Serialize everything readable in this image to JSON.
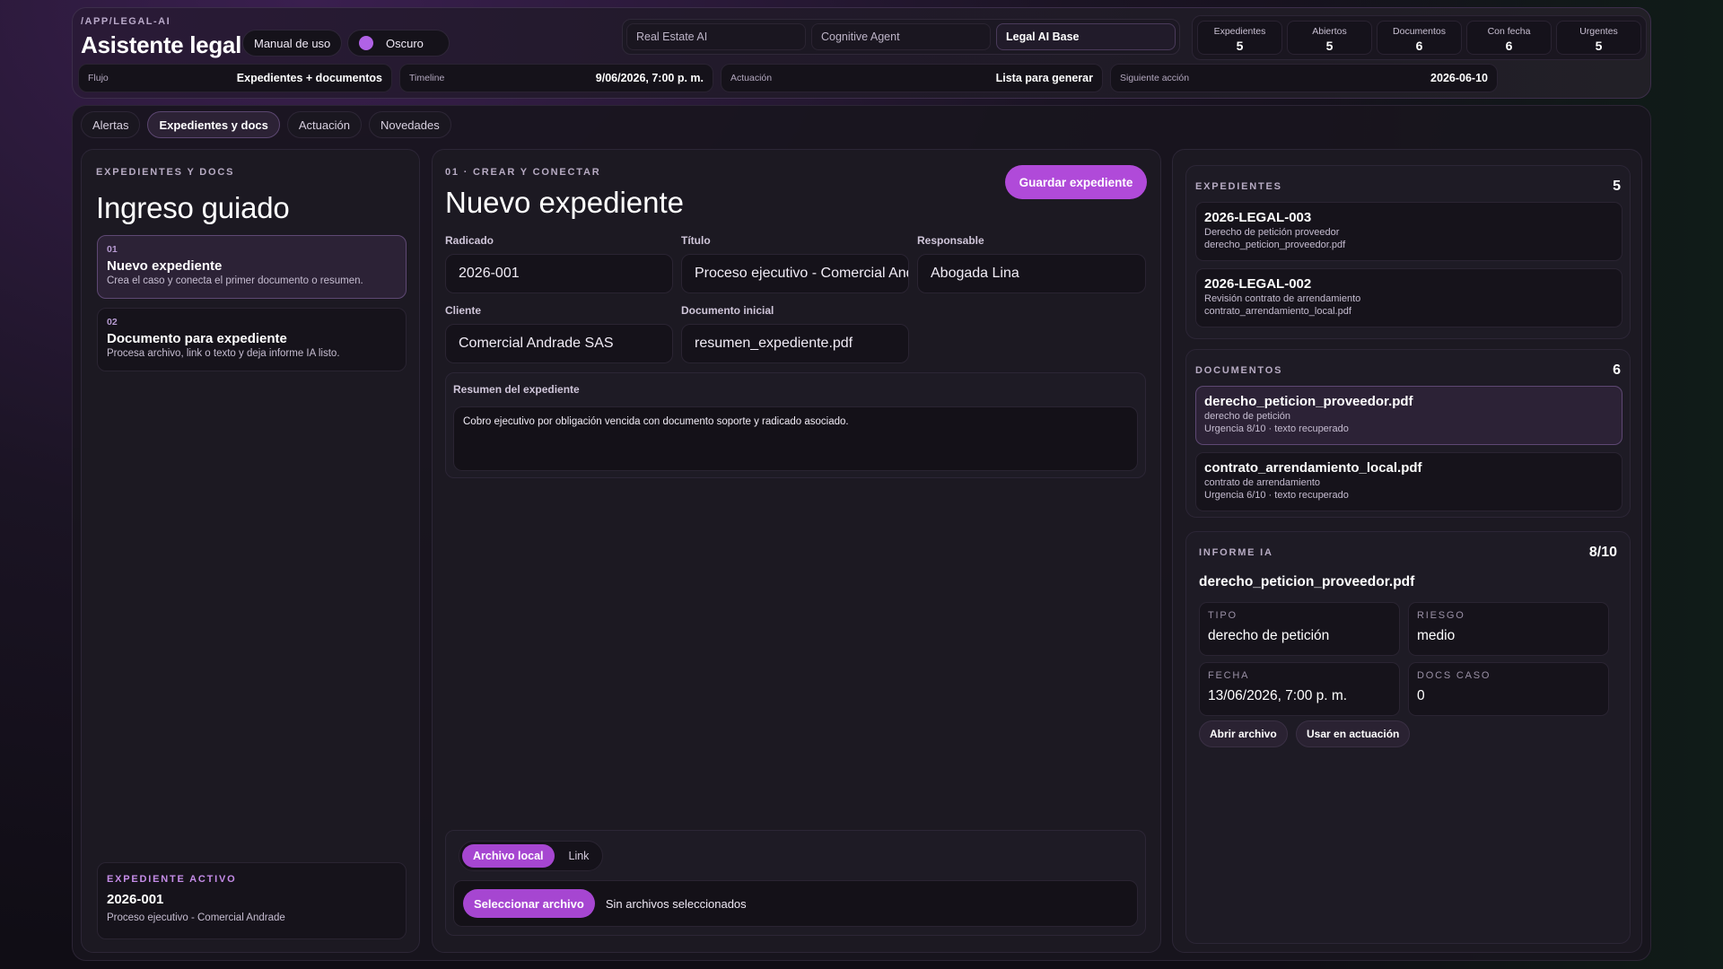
{
  "header": {
    "crumb": "/APP/LEGAL-AI",
    "title": "Asistente legal",
    "manual_label": "Manual de uso",
    "theme_label": "Oscuro",
    "workspaces": [
      "Real Estate AI",
      "Cognitive Agent",
      "Legal AI Base"
    ],
    "active_workspace": "Legal AI Base",
    "stats": [
      {
        "label": "Expedientes",
        "value": "5"
      },
      {
        "label": "Abiertos",
        "value": "5"
      },
      {
        "label": "Documentos",
        "value": "6"
      },
      {
        "label": "Con fecha",
        "value": "6"
      },
      {
        "label": "Urgentes",
        "value": "5"
      }
    ],
    "meta": [
      {
        "key": "Flujo",
        "value": "Expedientes + documentos"
      },
      {
        "key": "Timeline",
        "value": "9/06/2026, 7:00 p. m."
      },
      {
        "key": "Actuación",
        "value": "Lista para generar"
      },
      {
        "key": "Siguiente acción",
        "value": "2026-06-10"
      }
    ]
  },
  "tabs": [
    "Alertas",
    "Expedientes y docs",
    "Actuación",
    "Novedades"
  ],
  "active_tab": "Expedientes y docs",
  "left": {
    "eyebrow": "EXPEDIENTES Y DOCS",
    "title": "Ingreso guiado",
    "steps": [
      {
        "num": "01",
        "title": "Nuevo expediente",
        "desc": "Crea el caso y conecta el primer documento o resumen."
      },
      {
        "num": "02",
        "title": "Documento para expediente",
        "desc": "Procesa archivo, link o texto y deja informe IA listo."
      }
    ],
    "active_case": {
      "eyebrow": "EXPEDIENTE ACTIVO",
      "id": "2026-001",
      "subtitle": "Proceso ejecutivo - Comercial Andrade"
    }
  },
  "center": {
    "eyebrow": "01 · CREAR Y CONECTAR",
    "title": "Nuevo expediente",
    "save_label": "Guardar expediente",
    "fields": {
      "radicado": {
        "label": "Radicado",
        "value": "2026-001"
      },
      "titulo": {
        "label": "Título",
        "value": "Proceso ejecutivo - Comercial Andrade"
      },
      "responsable": {
        "label": "Responsable",
        "value": "Abogada Lina"
      },
      "cliente": {
        "label": "Cliente",
        "value": "Comercial Andrade SAS"
      },
      "documento": {
        "label": "Documento inicial",
        "value": "resumen_expediente.pdf"
      }
    },
    "summary": {
      "label": "Resumen del expediente",
      "value": "Cobro ejecutivo por obligación vencida con documento soporte y radicado asociado."
    },
    "upload": {
      "modes": [
        "Archivo local",
        "Link"
      ],
      "active_mode": "Archivo local",
      "button": "Seleccionar archivo",
      "status": "Sin archivos seleccionados"
    }
  },
  "right": {
    "expedientes": {
      "label": "EXPEDIENTES",
      "count": "5",
      "items": [
        {
          "id": "2026-LEGAL-003",
          "line1": "Derecho de petición proveedor",
          "line2": "derecho_peticion_proveedor.pdf"
        },
        {
          "id": "2026-LEGAL-002",
          "line1": "Revisión contrato de arrendamiento",
          "line2": "contrato_arrendamiento_local.pdf"
        }
      ]
    },
    "documentos": {
      "label": "DOCUMENTOS",
      "count": "6",
      "items": [
        {
          "name": "derecho_peticion_proveedor.pdf",
          "type": "derecho de petición",
          "meta": "Urgencia 8/10 · texto recuperado"
        },
        {
          "name": "contrato_arrendamiento_local.pdf",
          "type": "contrato de arrendamiento",
          "meta": "Urgencia 6/10 · texto recuperado"
        }
      ]
    },
    "informe": {
      "label": "INFORME IA",
      "score": "8/10",
      "file": "derecho_peticion_proveedor.pdf",
      "tipo": {
        "k": "TIPO",
        "v": "derecho de petición"
      },
      "riesgo": {
        "k": "RIESGO",
        "v": "medio"
      },
      "fecha": {
        "k": "FECHA",
        "v": "13/06/2026, 7:00 p. m."
      },
      "docs": {
        "k": "DOCS CASO",
        "v": "0"
      },
      "open_label": "Abrir archivo",
      "use_label": "Usar en actuación"
    }
  },
  "colors": {
    "accent": "#b04ad9",
    "panel": "#1c1922"
  }
}
